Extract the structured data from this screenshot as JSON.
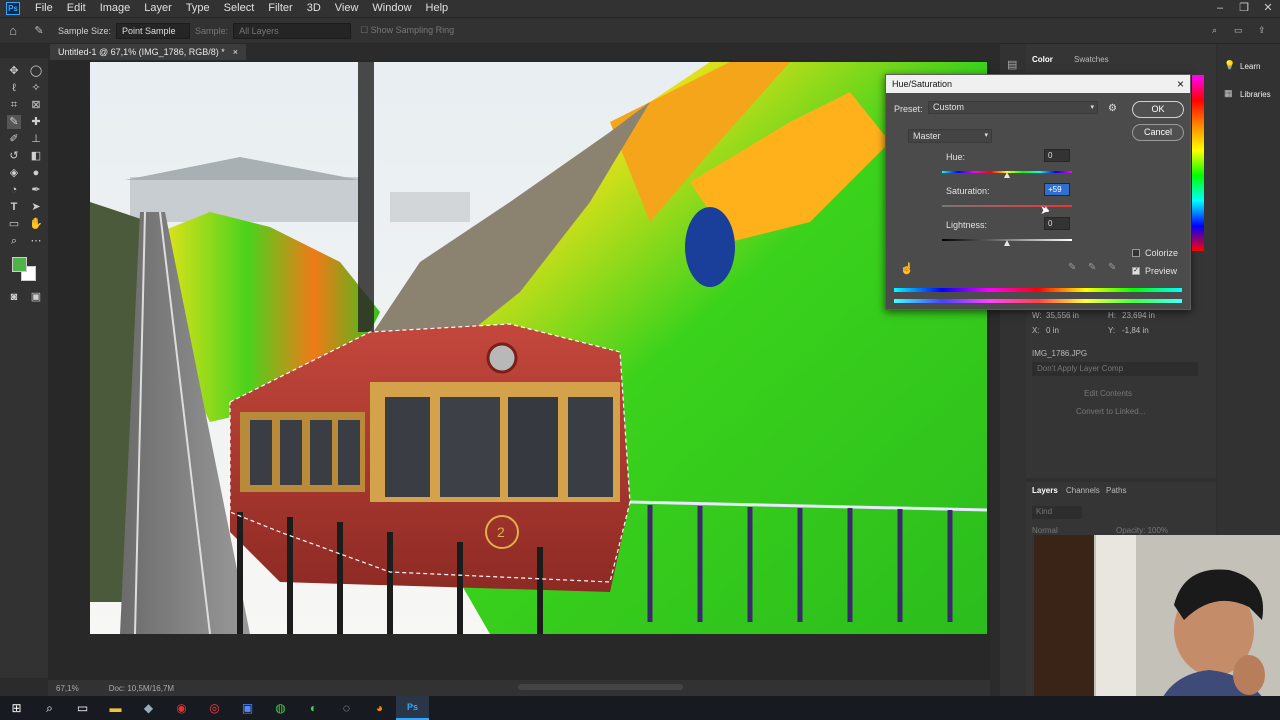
{
  "app": {
    "logo": "Ps"
  },
  "menu": [
    "File",
    "Edit",
    "Image",
    "Layer",
    "Type",
    "Select",
    "Filter",
    "3D",
    "View",
    "Window",
    "Help"
  ],
  "options_bar": {
    "sample_size_label": "Sample Size:",
    "sample_size_value": "Point Sample",
    "sample_label": "Sample:",
    "sample_value": "All Layers",
    "show_ring_label": "Show Sampling Ring"
  },
  "document_tab": {
    "title": "Untitled-1 @ 67,1% (IMG_1786, RGB/8) *",
    "close": "×"
  },
  "status_bar": {
    "zoom": "67,1%",
    "doc_info": "Doc: 10,5M/16,7M"
  },
  "right_panels": {
    "color_tabs": [
      "Color",
      "Swatches"
    ],
    "learn": "Learn",
    "libraries": "Libraries",
    "properties": {
      "w_label": "W:",
      "w_value": "35,556 in",
      "h_label": "H:",
      "h_value": "23,694 in",
      "x_label": "X:",
      "x_value": "0 in",
      "y_label": "Y:",
      "y_value": "-1,84 in",
      "file_name": "IMG_1786.JPG",
      "comp_dropdown": "Don't Apply Layer Comp",
      "edit_contents": "Edit Contents",
      "convert_linked": "Convert to Linked..."
    },
    "layers_tabs": [
      "Layers",
      "Channels",
      "Paths"
    ],
    "layers_search": "Kind",
    "blend_mode": "Normal",
    "opacity": "Opacity: 100%"
  },
  "dialog": {
    "title": "Hue/Saturation",
    "close": "×",
    "preset_label": "Preset:",
    "preset_value": "Custom",
    "channel": "Master",
    "hue_label": "Hue:",
    "hue_value": "0",
    "saturation_label": "Saturation:",
    "saturation_value": "+59",
    "lightness_label": "Lightness:",
    "lightness_value": "0",
    "ok": "OK",
    "cancel": "Cancel",
    "colorize": "Colorize",
    "preview": "Preview",
    "hue_range": [
      -180,
      180
    ],
    "saturation_range": [
      -100,
      100
    ],
    "lightness_range": [
      -100,
      100
    ],
    "saturation_level": 59
  },
  "taskbar_icons": [
    "windows-start-icon",
    "search-icon",
    "task-view-icon",
    "file-explorer-icon",
    "app-icon",
    "app-icon",
    "app-icon",
    "app-icon",
    "chrome-icon",
    "app-icon",
    "app-icon",
    "firefox-icon",
    "photoshop-icon"
  ],
  "accent": "#31a8ff"
}
